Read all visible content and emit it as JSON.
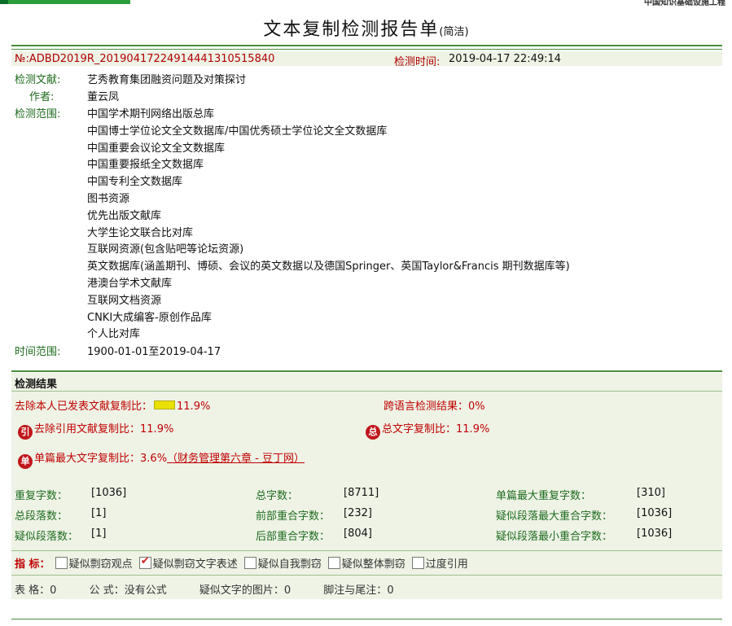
{
  "header": {
    "top_right_text": "中国知识基础设施工程",
    "title": "文本复制检测报告单",
    "title_suffix": "(简洁)"
  },
  "report": {
    "number": "№:ADBD2019R_20190417224914441310515840",
    "time_label": "检测时间:",
    "time_value": "2019-04-17 22:49:14",
    "doc_label": "检测文献:",
    "doc_value": "艺秀教育集团融资问题及对策探讨",
    "author_label": "作者:",
    "author_value": "董云凤",
    "scope_label": "检测范围:",
    "scope_items": [
      "中国学术期刊网络出版总库",
      "中国博士学位论文全文数据库/中国优秀硕士学位论文全文数据库",
      "中国重要会议论文全文数据库",
      "中国重要报纸全文数据库",
      "中国专利全文数据库",
      "图书资源",
      "优先出版文献库",
      "大学生论文联合比对库",
      "互联网资源(包含贴吧等论坛资源)",
      "英文数据库(涵盖期刊、博硕、会议的英文数据以及德国Springer、英国Taylor&Francis 期刊数据库等)",
      "港澳台学术文献库",
      "互联网文档资源",
      "CNKI大成编客-原创作品库",
      "个人比对库"
    ],
    "period_label": "时间范围:",
    "period_value": "1900-01-01至2019-04-17"
  },
  "results": {
    "section_title": "检测结果",
    "excl_self_label": "去除本人已发表文献复制比：",
    "excl_self_value": "11.9%",
    "cross_lang_label": "跨语言检测结果：",
    "cross_lang_value": "0%",
    "excl_cite_badge": "引",
    "excl_cite_label": "去除引用文献复制比：",
    "excl_cite_value": "11.9%",
    "total_badge": "总",
    "total_label": "总文字复制比：",
    "total_value": "11.9%",
    "single_badge": "单",
    "single_label": "单篇最大文字复制比：",
    "single_value": "3.6%",
    "single_source": "（财务管理第六章 - 豆丁网）",
    "excl_self_bar_fraction": 0.119
  },
  "stats": [
    [
      {
        "label": "重复字数：",
        "value": "[1036]"
      },
      {
        "label": "总字数：",
        "value": "[8711]"
      },
      {
        "label": "单篇最大重复字数：",
        "value": "[310]"
      }
    ],
    [
      {
        "label": "总段落数：",
        "value": "[1]"
      },
      {
        "label": "前部重合字数：",
        "value": "[232]"
      },
      {
        "label": "疑似段落最大重合字数：",
        "value": "[1036]"
      }
    ],
    [
      {
        "label": "疑似段落数：",
        "value": "[1]"
      },
      {
        "label": "后部重合字数：",
        "value": "[804]"
      },
      {
        "label": "疑似段落最小重合字数：",
        "value": "[1036]"
      }
    ]
  ],
  "indicators": {
    "label": "指 标：",
    "items": [
      {
        "label": "疑似剽窃观点",
        "checked": false
      },
      {
        "label": "疑似剽窃文字表述",
        "checked": true
      },
      {
        "label": "疑似自我剽窃",
        "checked": false
      },
      {
        "label": "疑似整体剽窃",
        "checked": false
      },
      {
        "label": "过度引用",
        "checked": false
      }
    ]
  },
  "footer_stats": {
    "table_label": "表 格：",
    "table_value": "0",
    "formula_label": "公 式：",
    "formula_value": "没有公式",
    "image_label": "疑似文字的图片：",
    "image_value": "0",
    "footnote_label": "脚注与尾注：",
    "footnote_value": "0"
  },
  "colors": {
    "accent_green": "#1e6b1e",
    "rule_green": "#4a8d3a",
    "alert_red": "#c00000",
    "badge_red": "#c0161b"
  }
}
